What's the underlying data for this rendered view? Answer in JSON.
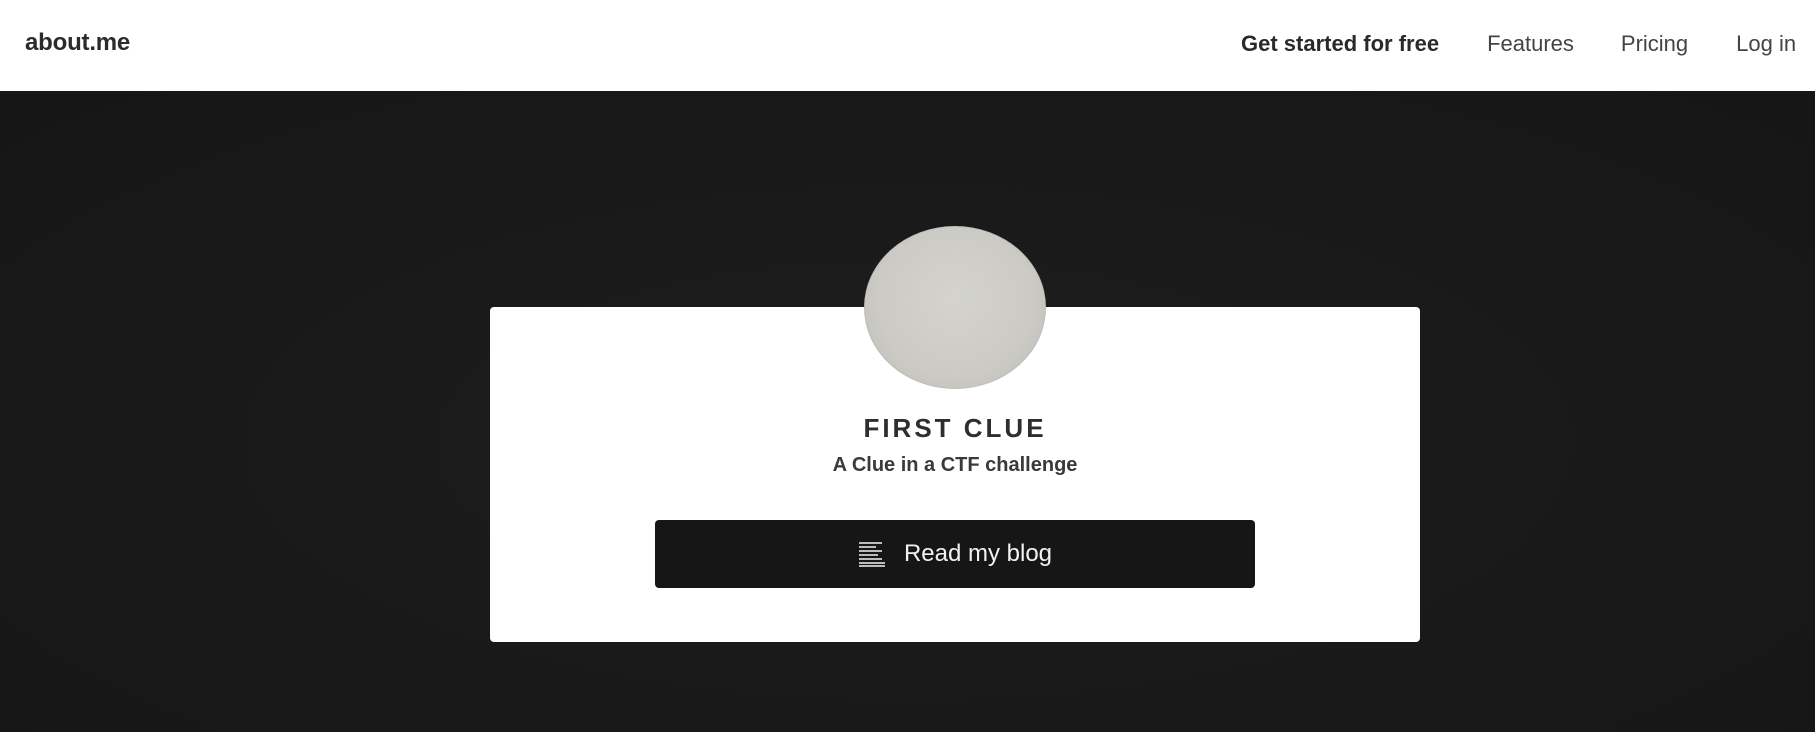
{
  "header": {
    "brand": "about.me",
    "nav": {
      "cta_label": "Get started for free",
      "features_label": "Features",
      "pricing_label": "Pricing",
      "login_label": "Log in"
    }
  },
  "profile": {
    "name": "FIRST CLUE",
    "headline": "A Clue in a CTF challenge",
    "blog_button_label": "Read my blog",
    "blog_icon": "document-lines-icon",
    "avatar_icon": "profile-photo"
  },
  "colors": {
    "header_bg": "#ffffff",
    "hero_bg": "#1a1a1a",
    "card_bg": "#ffffff",
    "button_bg": "#161616",
    "button_text": "#f2f2f2",
    "avatar_fill": "#cbcac5"
  }
}
